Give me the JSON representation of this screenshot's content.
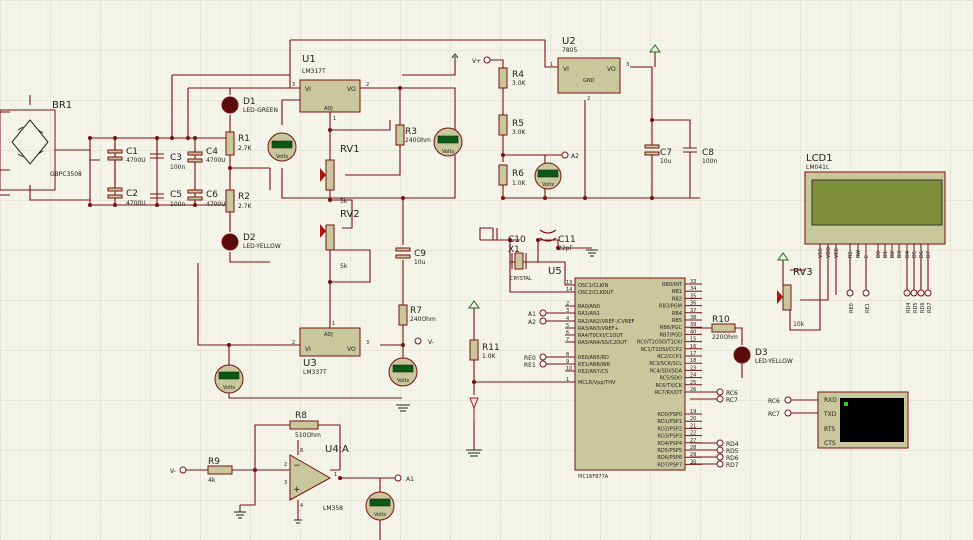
{
  "components": {
    "br1": {
      "ref": "BR1",
      "value": "GBPC3508"
    },
    "c1": {
      "ref": "C1",
      "value": "4700U"
    },
    "c2": {
      "ref": "C2",
      "value": "4700U"
    },
    "c3": {
      "ref": "C3",
      "value": "100n"
    },
    "c4": {
      "ref": "C4",
      "value": "4700U"
    },
    "c5": {
      "ref": "C5",
      "value": "100n"
    },
    "c6": {
      "ref": "C6",
      "value": "4700U"
    },
    "c7": {
      "ref": "C7",
      "value": "10u"
    },
    "c8": {
      "ref": "C8",
      "value": "100n"
    },
    "c9": {
      "ref": "C9",
      "value": "10u"
    },
    "c10": {
      "ref": "C10"
    },
    "c11": {
      "ref": "C11",
      "value": "22pF"
    },
    "d1": {
      "ref": "D1",
      "value": "LED-GREEN"
    },
    "d2": {
      "ref": "D2",
      "value": "LED-YELLOW"
    },
    "d3": {
      "ref": "D3",
      "value": "LED-YELLOW"
    },
    "r1": {
      "ref": "R1",
      "value": "2.7K"
    },
    "r2": {
      "ref": "R2",
      "value": "2.7K"
    },
    "r3": {
      "ref": "R3",
      "value": "240Ohm"
    },
    "r4": {
      "ref": "R4",
      "value": "3.0K"
    },
    "r5": {
      "ref": "R5",
      "value": "3.0K"
    },
    "r6": {
      "ref": "R6",
      "value": "1.0K"
    },
    "r7": {
      "ref": "R7",
      "value": "240Ohm"
    },
    "r8": {
      "ref": "R8",
      "value": "510Ohm"
    },
    "r9": {
      "ref": "R9",
      "value": "4k"
    },
    "r10": {
      "ref": "R10",
      "value": "220Ohm"
    },
    "r11": {
      "ref": "R11",
      "value": "1.0K"
    },
    "rv1": {
      "ref": "RV1",
      "value": "5k"
    },
    "rv2": {
      "ref": "RV2",
      "value": "5k"
    },
    "rv3": {
      "ref": "RV3",
      "value": "10k"
    },
    "u1": {
      "ref": "U1",
      "value": "LM317T"
    },
    "u2": {
      "ref": "U2",
      "value": "7805"
    },
    "u3": {
      "ref": "U3",
      "value": "LM337T"
    },
    "u4": {
      "ref": "U4:A",
      "value": "LM358"
    },
    "x1": {
      "ref": "X1",
      "value": "CRYSTAL"
    },
    "lcd1": {
      "ref": "LCD1",
      "value": "LM041L"
    },
    "u5": {
      "ref": "U5",
      "value": "PIC16F877A"
    }
  },
  "meter_label": "Volts",
  "nets": {
    "vplus": "V+",
    "vminus": "V-",
    "a1": "A1",
    "a2": "A2",
    "rc6": "RC6",
    "rc7": "RC7",
    "re0": "RE0",
    "re1": "RE1",
    "rd4": "RD4",
    "rd5": "RD5",
    "rd6": "RD6",
    "rd7": "RD7"
  },
  "regulator_pins": {
    "vi": "VI",
    "vo": "VO",
    "adj": "ADJ",
    "gnd": "GND"
  },
  "pin_numbers": {
    "u1_vi": "3",
    "u1_vo": "2",
    "u1_adj": "1",
    "u2_vi": "1",
    "u2_vo": "3",
    "u2_gnd": "2",
    "u3_vi": "2",
    "u3_vo": "3",
    "u3_adj": "1",
    "u4_out": "1",
    "u4_inm": "2",
    "u4_inp": "3",
    "u4_v": "8",
    "u4_g": "4"
  },
  "pic_left_pins": [
    {
      "num": "13",
      "name": "OSC1/CLKIN"
    },
    {
      "num": "14",
      "name": "OSC2/CLKOUT"
    },
    {
      "num": "2",
      "name": "RA0/AN0"
    },
    {
      "num": "3",
      "name": "RA1/AN1"
    },
    {
      "num": "4",
      "name": "RA2/AN2/VREF-/CVREF"
    },
    {
      "num": "5",
      "name": "RA3/AN3/VREF+"
    },
    {
      "num": "6",
      "name": "RA4/T0CKI/C1OUT"
    },
    {
      "num": "7",
      "name": "RA5/AN4/SS/C2OUT"
    },
    {
      "num": "8",
      "name": "RE0/AN5/RD"
    },
    {
      "num": "9",
      "name": "RE1/AN6/WR"
    },
    {
      "num": "10",
      "name": "RE2/AN7/CS"
    },
    {
      "num": "1",
      "name": "MCLR/Vpp/THV"
    }
  ],
  "pic_right_pins": [
    {
      "num": "33",
      "name": "RB0/INT"
    },
    {
      "num": "34",
      "name": "RB1"
    },
    {
      "num": "35",
      "name": "RB2"
    },
    {
      "num": "36",
      "name": "RB3/PGM"
    },
    {
      "num": "37",
      "name": "RB4"
    },
    {
      "num": "38",
      "name": "RB5"
    },
    {
      "num": "39",
      "name": "RB6/PGC"
    },
    {
      "num": "40",
      "name": "RB7/PGD"
    },
    {
      "num": "15",
      "name": "RC0/T1OSO/T1CKI"
    },
    {
      "num": "16",
      "name": "RC1/T1OSI/CCP2"
    },
    {
      "num": "17",
      "name": "RC2/CCP1"
    },
    {
      "num": "18",
      "name": "RC3/SCK/SCL"
    },
    {
      "num": "23",
      "name": "RC4/SDI/SDA"
    },
    {
      "num": "24",
      "name": "RC5/SDO"
    },
    {
      "num": "25",
      "name": "RC6/TX/CK"
    },
    {
      "num": "26",
      "name": "RC7/RX/DT"
    },
    {
      "num": "19",
      "name": "RD0/PSP0"
    },
    {
      "num": "20",
      "name": "RD1/PSP1"
    },
    {
      "num": "21",
      "name": "RD2/PSP2"
    },
    {
      "num": "22",
      "name": "RD3/PSP3"
    },
    {
      "num": "27",
      "name": "RD4/PSP4"
    },
    {
      "num": "28",
      "name": "RD5/PSP5"
    },
    {
      "num": "29",
      "name": "RD6/PSP6"
    },
    {
      "num": "30",
      "name": "RD7/PSP7"
    }
  ],
  "lcd_pins": [
    "VSS",
    "VDD",
    "VEE",
    "RS",
    "RW",
    "E",
    "D0",
    "D1",
    "D2",
    "D3",
    "D4",
    "D5",
    "D6",
    "D7"
  ],
  "lcd_net_labels": [
    "RE0",
    "RE1",
    "RD4",
    "RD5",
    "RD6",
    "RD7"
  ],
  "terminal_pins": [
    "RXD",
    "TXD",
    "RTS",
    "CTS"
  ]
}
